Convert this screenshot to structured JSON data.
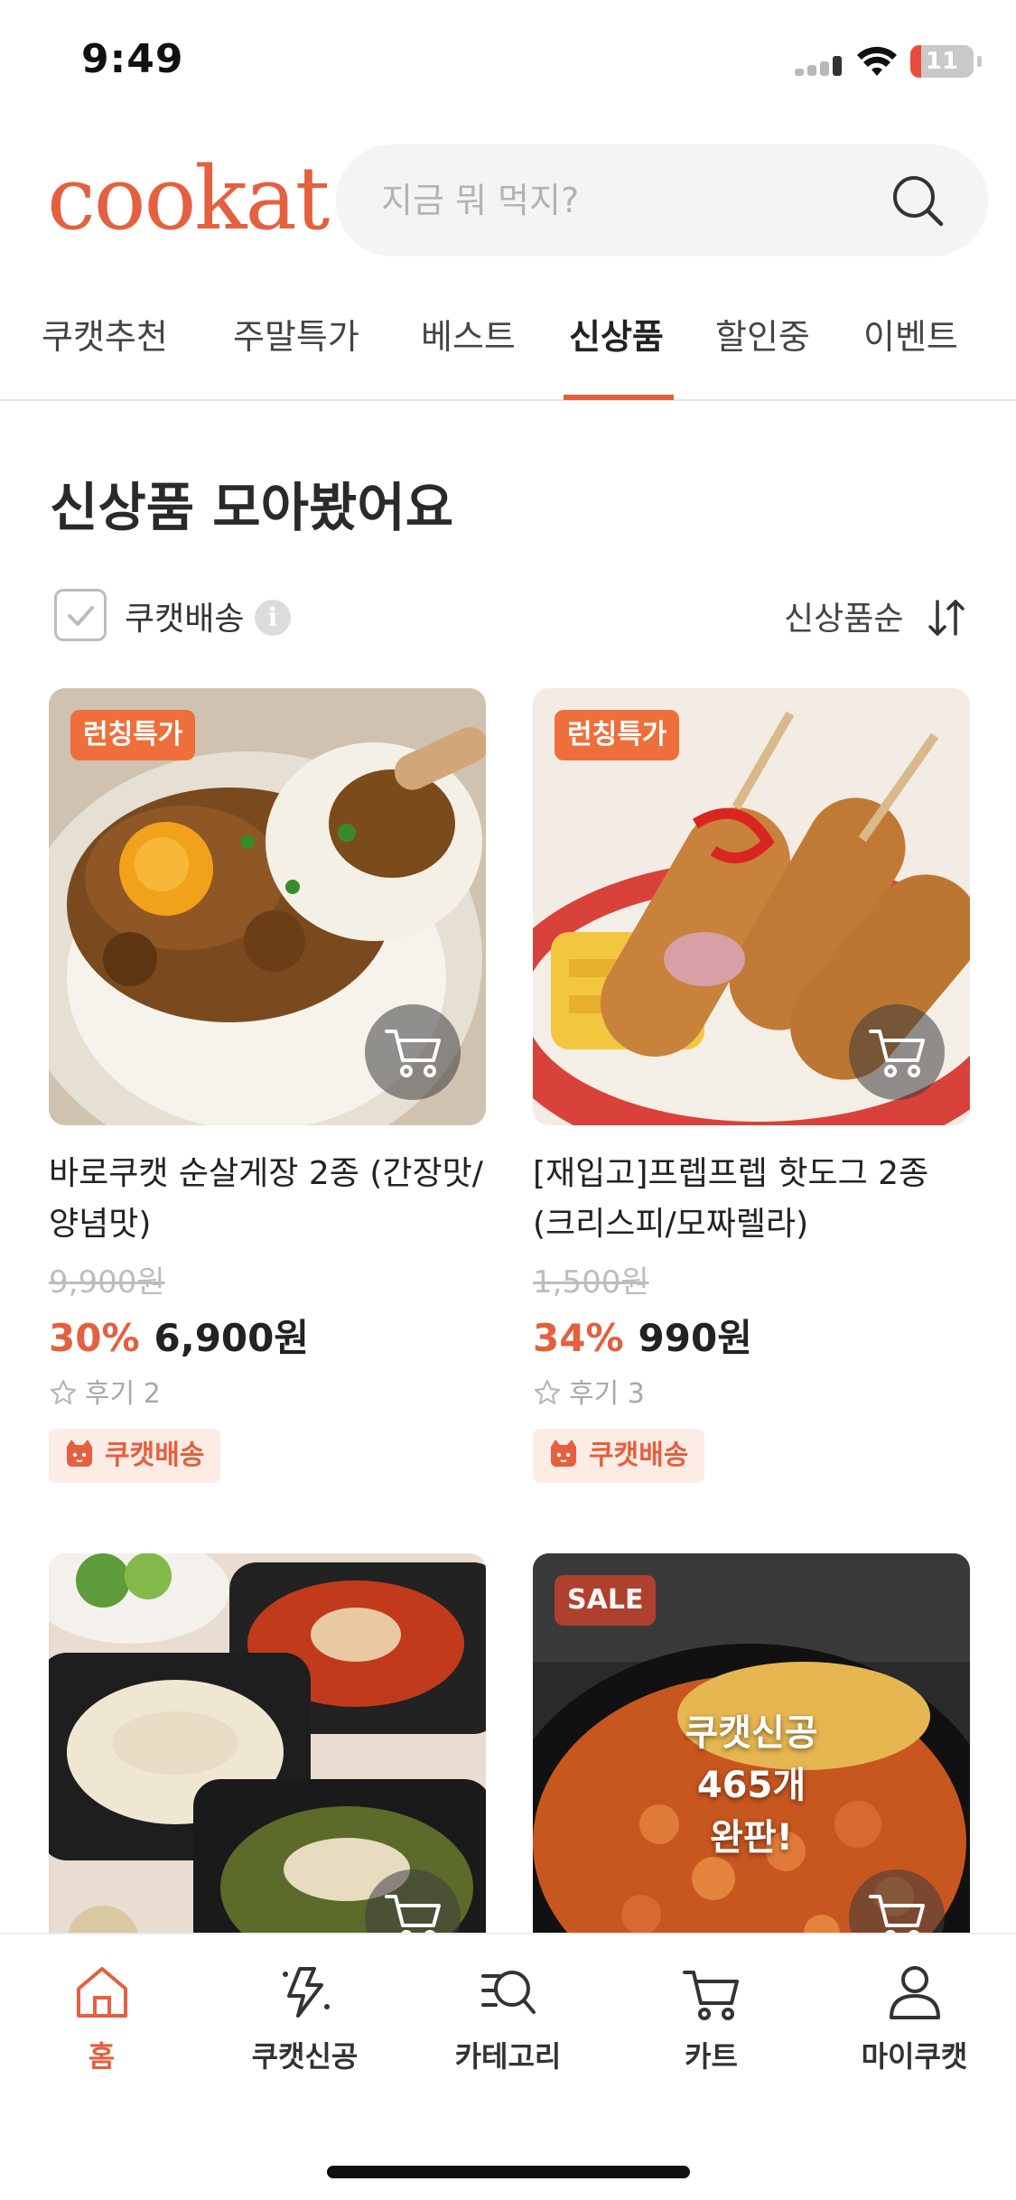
{
  "status_bar": {
    "time": "9:49",
    "battery": "11"
  },
  "header": {
    "logo": "cookat",
    "search_placeholder": "지금 뭐 먹지?"
  },
  "tabs": [
    {
      "label": "쿠캣추천",
      "active": false
    },
    {
      "label": "주말특가",
      "active": false
    },
    {
      "label": "베스트",
      "active": false
    },
    {
      "label": "신상품",
      "active": true
    },
    {
      "label": "할인중",
      "active": false
    },
    {
      "label": "이벤트",
      "active": false
    }
  ],
  "section": {
    "title": "신상품 모아봤어요",
    "filter_label": "쿠캣배송",
    "filter_checked": false,
    "sort_label": "신상품순"
  },
  "products": [
    {
      "badge": "런칭특가",
      "name": "바로쿠캣 순살게장 2종 (간장맛/양념맛)",
      "original_price": "9,900원",
      "discount": "30%",
      "price": "6,900원",
      "review": "후기 2",
      "shipping": "쿠캣배송"
    },
    {
      "badge": "런칭특가",
      "name": "[재입고]프렙프렙 핫도그 2종 (크리스피/모짜렐라)",
      "original_price": "1,500원",
      "discount": "34%",
      "price": "990원",
      "review": "후기 3",
      "shipping": "쿠캣배송"
    },
    {
      "badge": "",
      "name": "",
      "overlay": ""
    },
    {
      "badge": "SALE",
      "name": "",
      "overlay_lines": [
        "쿠캣신공",
        "465개",
        "완판!"
      ]
    }
  ],
  "bottom_nav": [
    {
      "label": "홈",
      "icon": "home-icon",
      "active": true
    },
    {
      "label": "쿠캣신공",
      "icon": "lightning-icon",
      "active": false
    },
    {
      "label": "카테고리",
      "icon": "category-search-icon",
      "active": false
    },
    {
      "label": "카트",
      "icon": "cart-icon",
      "active": false
    },
    {
      "label": "마이쿠캣",
      "icon": "person-icon",
      "active": false
    }
  ],
  "colors": {
    "accent": "#e4603f",
    "badge": "#ee6f3c",
    "ship_bg": "#fdece6"
  }
}
